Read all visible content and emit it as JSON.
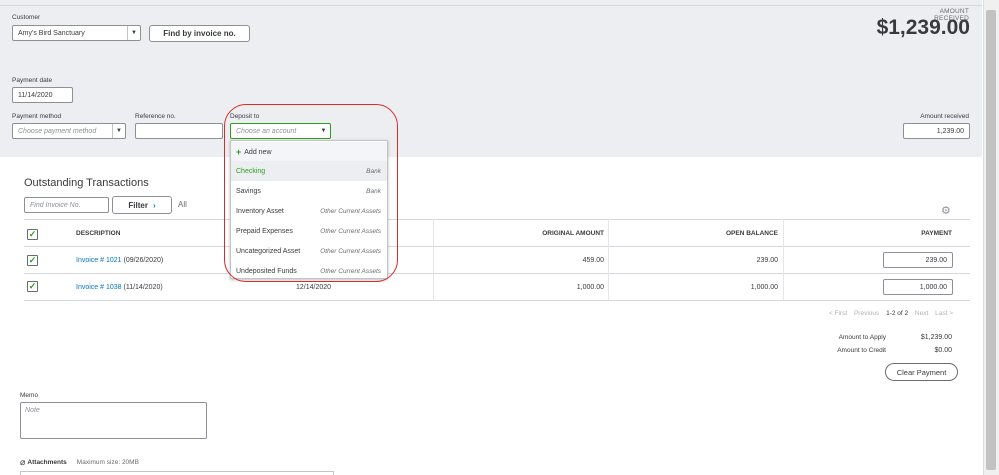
{
  "header": {
    "customer_label": "Customer",
    "customer_value": "Amy's Bird Sanctuary",
    "find_invoice_label": "Find by invoice no.",
    "amount_received_caption": "AMOUNT RECEIVED",
    "amount_received_big": "$1,239.00",
    "payment_date_label": "Payment date",
    "payment_date_value": "11/14/2020",
    "payment_method_label": "Payment method",
    "payment_method_placeholder": "Choose payment method",
    "reference_label": "Reference no.",
    "reference_value": "",
    "deposit_to_label": "Deposit to",
    "deposit_to_placeholder": "Choose an account",
    "amount_received_label": "Amount received",
    "amount_received_value": "1,239.00"
  },
  "dropdown": {
    "add_new": "Add new",
    "items": [
      {
        "name": "Checking",
        "type": "Bank"
      },
      {
        "name": "Savings",
        "type": "Bank"
      },
      {
        "name": "Inventory Asset",
        "type": "Other Current Assets"
      },
      {
        "name": "Prepaid Expenses",
        "type": "Other Current Assets"
      },
      {
        "name": "Uncategorized Asset",
        "type": "Other Current Assets"
      },
      {
        "name": "Undeposited Funds",
        "type": "Other Current Assets"
      }
    ]
  },
  "outstanding": {
    "title": "Outstanding Transactions",
    "find_placeholder": "Find Invoice No.",
    "filter_label": "Filter",
    "all_label": "All",
    "columns": {
      "description": "DESCRIPTION",
      "original_amount": "ORIGINAL AMOUNT",
      "open_balance": "OPEN BALANCE",
      "payment": "PAYMENT"
    },
    "rows": [
      {
        "invoice": "Invoice # 1021",
        "date": "(09/26/2020)",
        "due": "",
        "original": "459.00",
        "open": "239.00",
        "payment": "239.00"
      },
      {
        "invoice": "Invoice # 1038",
        "date": "(11/14/2020)",
        "due": "12/14/2020",
        "original": "1,000.00",
        "open": "1,000.00",
        "payment": "1,000.00"
      }
    ],
    "pager": {
      "first": "< First",
      "previous": "Previous",
      "range": "1-2 of 2",
      "next": "Next",
      "last": "Last >"
    }
  },
  "summary": {
    "amount_to_apply_label": "Amount to Apply",
    "amount_to_apply_value": "$1,239.00",
    "amount_to_credit_label": "Amount to Credit",
    "amount_to_credit_value": "$0.00",
    "clear_payment_label": "Clear Payment"
  },
  "memo": {
    "label": "Memo",
    "placeholder": "Note"
  },
  "attachments": {
    "label": "Attachments",
    "max_size": "Maximum size: 20MB"
  },
  "colors": {
    "accent_green": "#2ca01c",
    "link_blue": "#0077c5",
    "highlight_red": "#d42c2c",
    "header_bg": "#eceef1"
  }
}
